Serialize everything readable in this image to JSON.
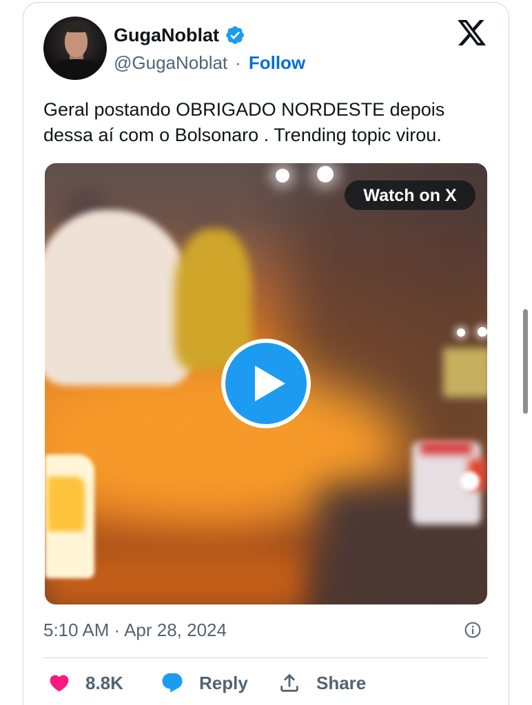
{
  "author": {
    "display_name": "GugaNoblat",
    "handle": "@GugaNoblat",
    "separator": "·",
    "follow_label": "Follow",
    "verified_icon": "verified-badge-icon"
  },
  "platform_icon": "x-logo-icon",
  "tweet": {
    "text": "Geral postando OBRIGADO NORDESTE depois dessa aí com o Bolsonaro . Trending topic virou.",
    "media": {
      "watch_label": "Watch on X",
      "play_icon": "play-icon"
    },
    "timestamp": "5:10 AM · Apr 28, 2024",
    "info_icon": "info-icon"
  },
  "actions": {
    "like": {
      "icon": "heart-icon",
      "count": "8.8K"
    },
    "reply": {
      "icon": "reply-icon",
      "label": "Reply"
    },
    "share": {
      "icon": "share-icon",
      "label": "Share"
    }
  },
  "colors": {
    "text_primary": "#0f1419",
    "text_secondary": "#536471",
    "follow_link": "#006fd6",
    "accent_blue": "#1d9bf0",
    "like_pink": "#f91880",
    "border": "#cfd9de"
  }
}
